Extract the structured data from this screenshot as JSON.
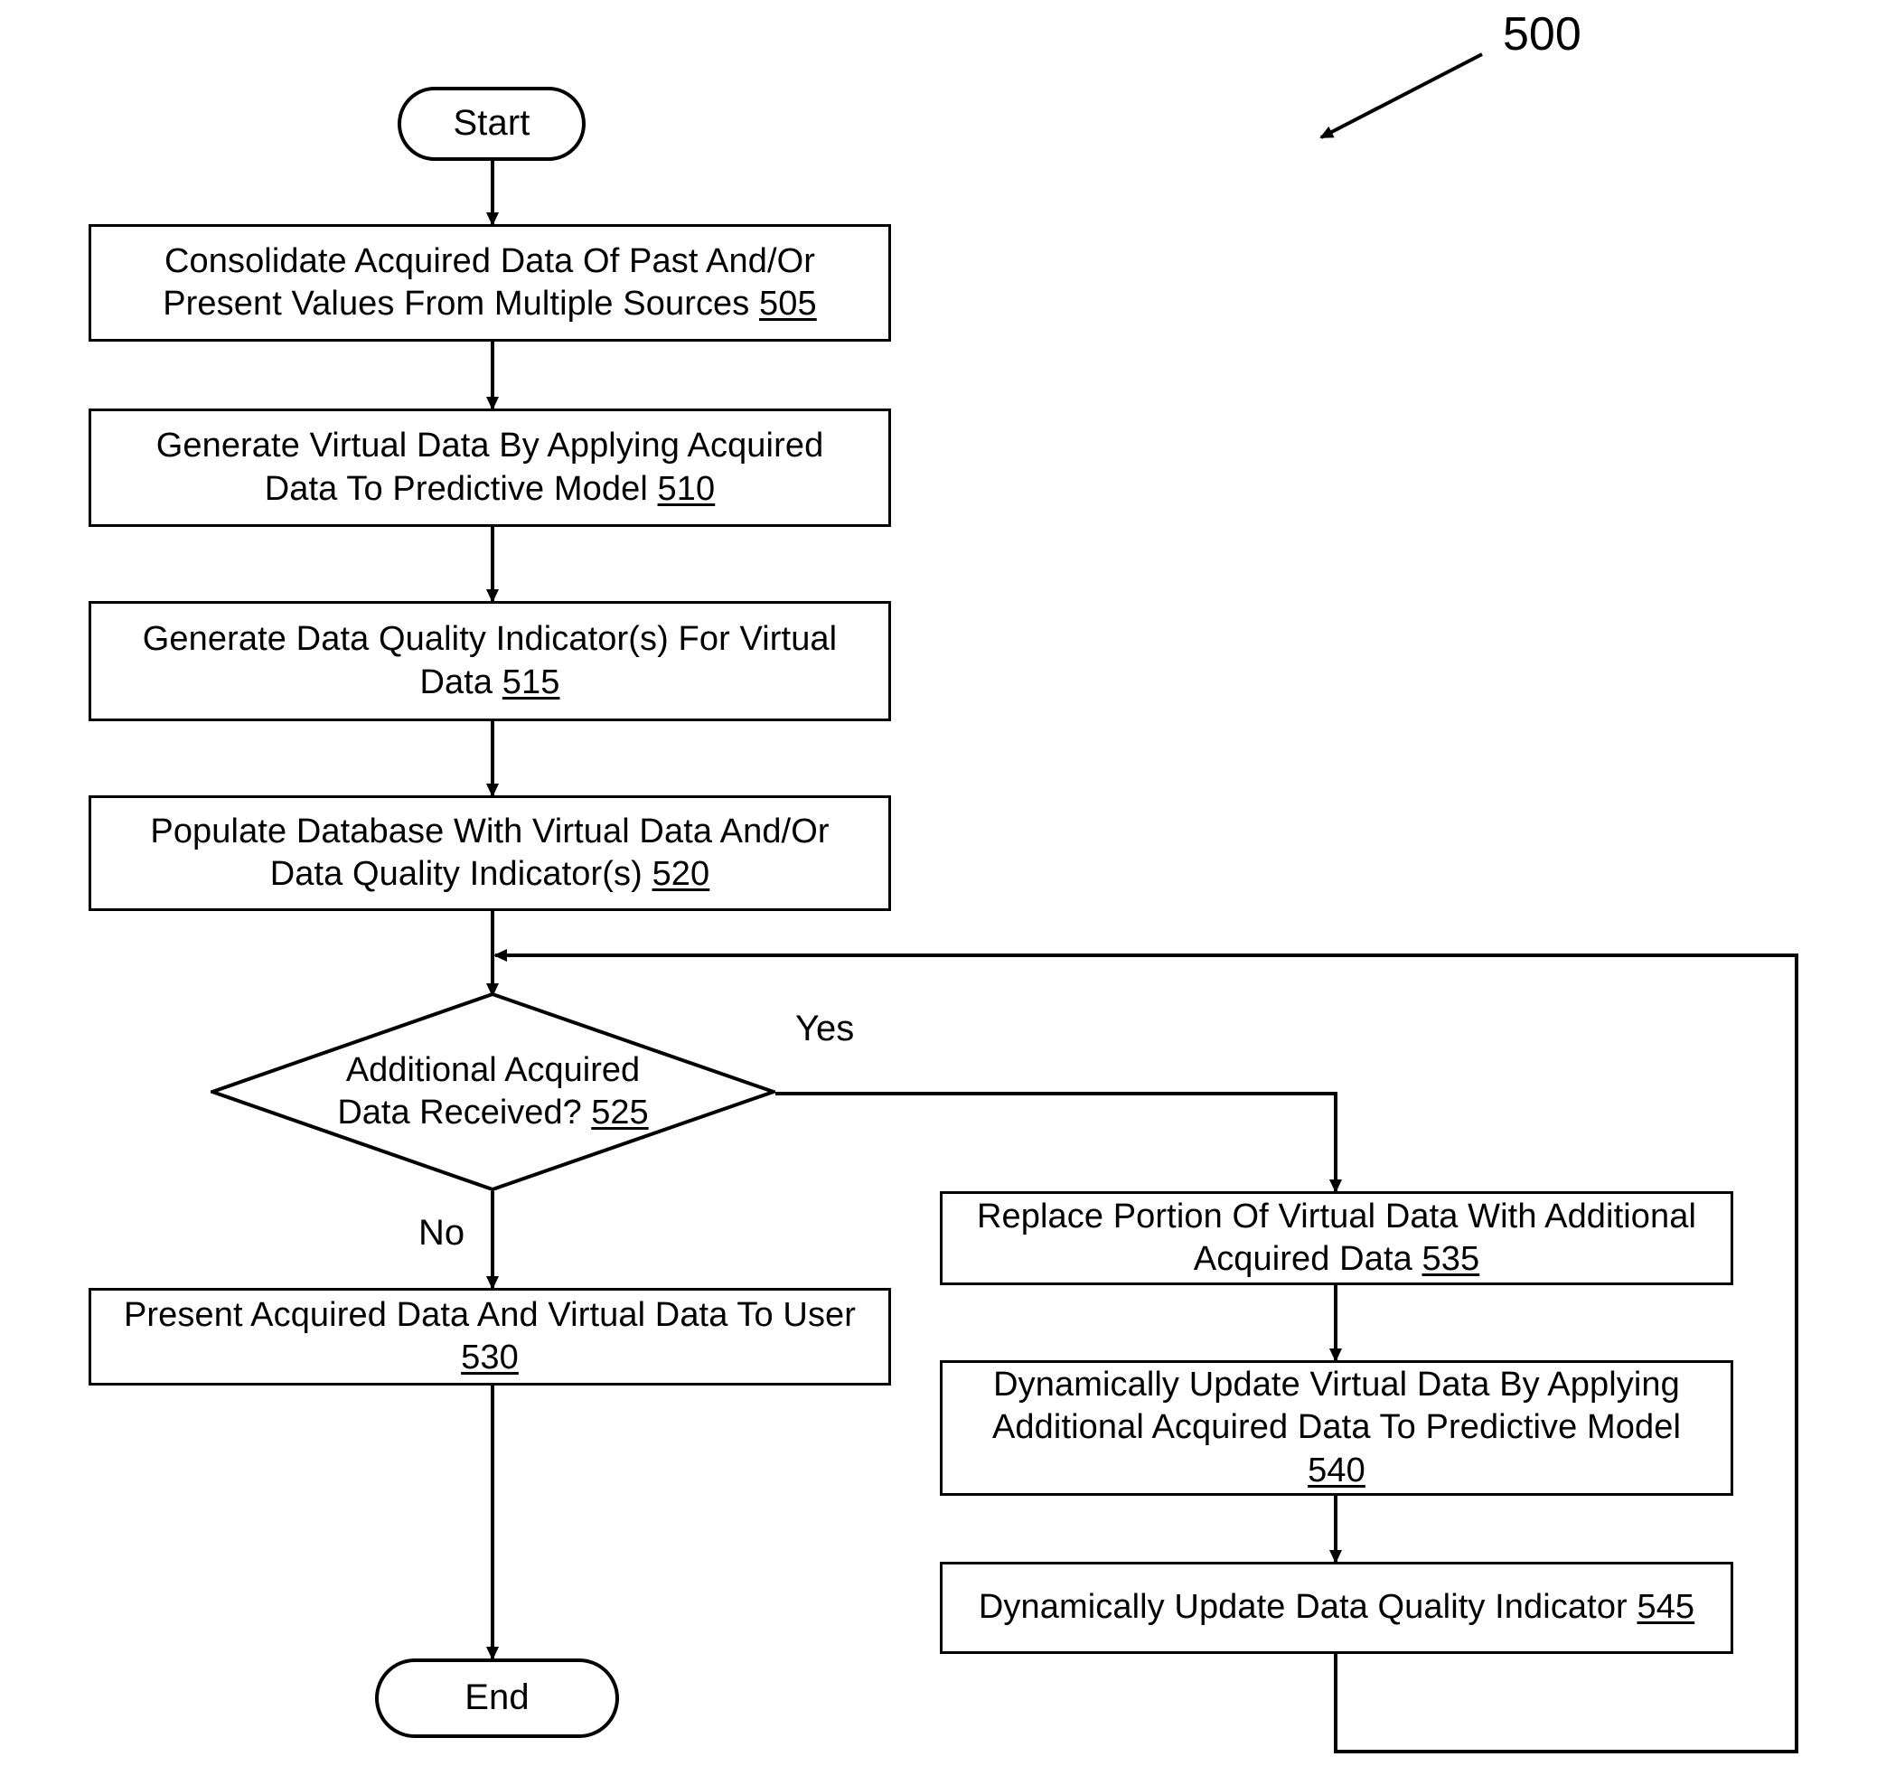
{
  "figure": {
    "number": "500"
  },
  "nodes": {
    "start": {
      "label": "Start",
      "shape": "terminal"
    },
    "step505": {
      "text": "Consolidate Acquired Data Of Past And/Or\nPresent Values From Multiple Sources ",
      "ref": "505",
      "shape": "process"
    },
    "step510": {
      "text": "Generate Virtual Data By Applying Acquired\nData To Predictive Model ",
      "ref": "510",
      "shape": "process"
    },
    "step515": {
      "text": "Generate Data Quality Indicator(s) For Virtual\nData ",
      "ref": "515",
      "shape": "process"
    },
    "step520": {
      "text": "Populate Database With Virtual Data And/Or\nData Quality Indicator(s) ",
      "ref": "520",
      "shape": "process"
    },
    "decision525": {
      "text": "Additional Acquired\nData Received? ",
      "ref": "525",
      "shape": "decision"
    },
    "step530": {
      "text": "Present Acquired Data And Virtual Data To User\n",
      "ref": "530",
      "shape": "process"
    },
    "step535": {
      "text": "Replace Portion Of Virtual Data With Additional\nAcquired Data ",
      "ref": "535",
      "shape": "process"
    },
    "step540": {
      "text": "Dynamically Update Virtual Data By Applying\nAdditional Acquired Data To Predictive Model\n",
      "ref": "540",
      "shape": "process"
    },
    "step545": {
      "text": "Dynamically Update Data Quality Indicator ",
      "ref": "545",
      "shape": "process"
    },
    "end": {
      "label": "End",
      "shape": "terminal"
    }
  },
  "edge_labels": {
    "yes": "Yes",
    "no": "No"
  },
  "colors": {
    "stroke": "#000000",
    "background": "#ffffff"
  }
}
